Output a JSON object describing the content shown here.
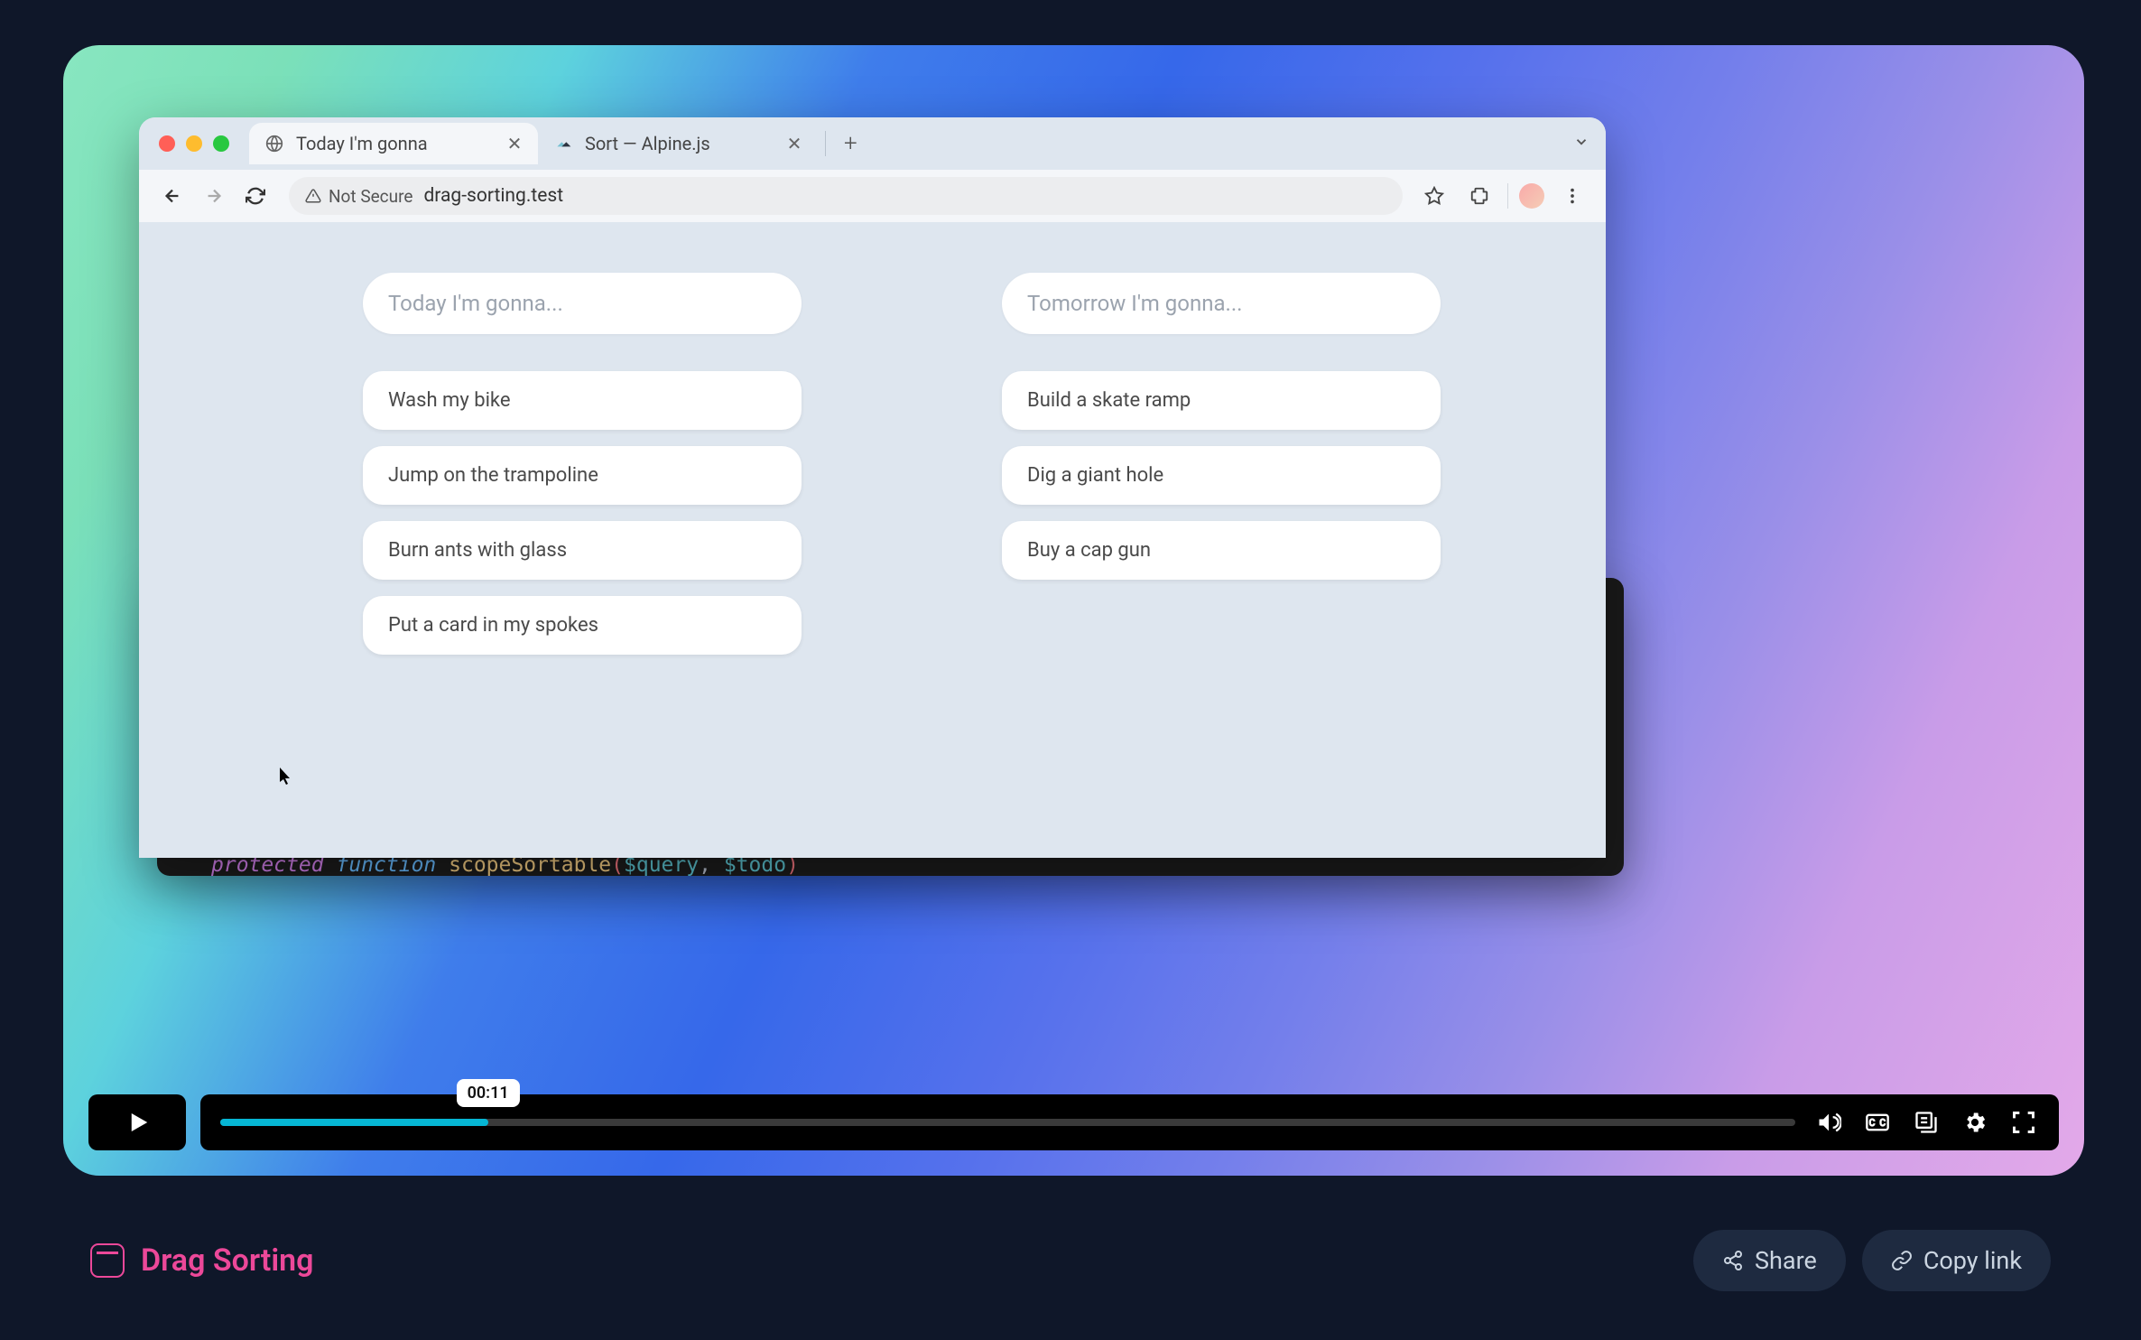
{
  "browser": {
    "tabs": [
      {
        "title": "Today I'm gonna",
        "active": true
      },
      {
        "title": "Sort — Alpine.js",
        "active": false
      }
    ],
    "security_label": "Not Secure",
    "url": "drag-sorting.test"
  },
  "page": {
    "left": {
      "placeholder": "Today I'm gonna...",
      "items": [
        "Wash my bike",
        "Jump on the trampoline",
        "Burn ants with glass",
        "Put a card in my spokes"
      ]
    },
    "right": {
      "placeholder": "Tomorrow I'm gonna...",
      "items": [
        "Build a skate ramp",
        "Dig a giant hole",
        "Buy a cap gun"
      ]
    }
  },
  "code": {
    "keyword1": "protected",
    "keyword2": "function",
    "fn": "scopeSortable",
    "paren_open": "(",
    "var1": "$query",
    "comma": ",",
    "var2": "$todo",
    "paren_close": ")"
  },
  "player": {
    "timestamp": "00:11",
    "progress_pct": 17
  },
  "video_title": "Drag Sorting",
  "actions": {
    "share": "Share",
    "copy": "Copy link"
  },
  "colors": {
    "accent": "#ec4899",
    "progress": "#06b6d4"
  }
}
